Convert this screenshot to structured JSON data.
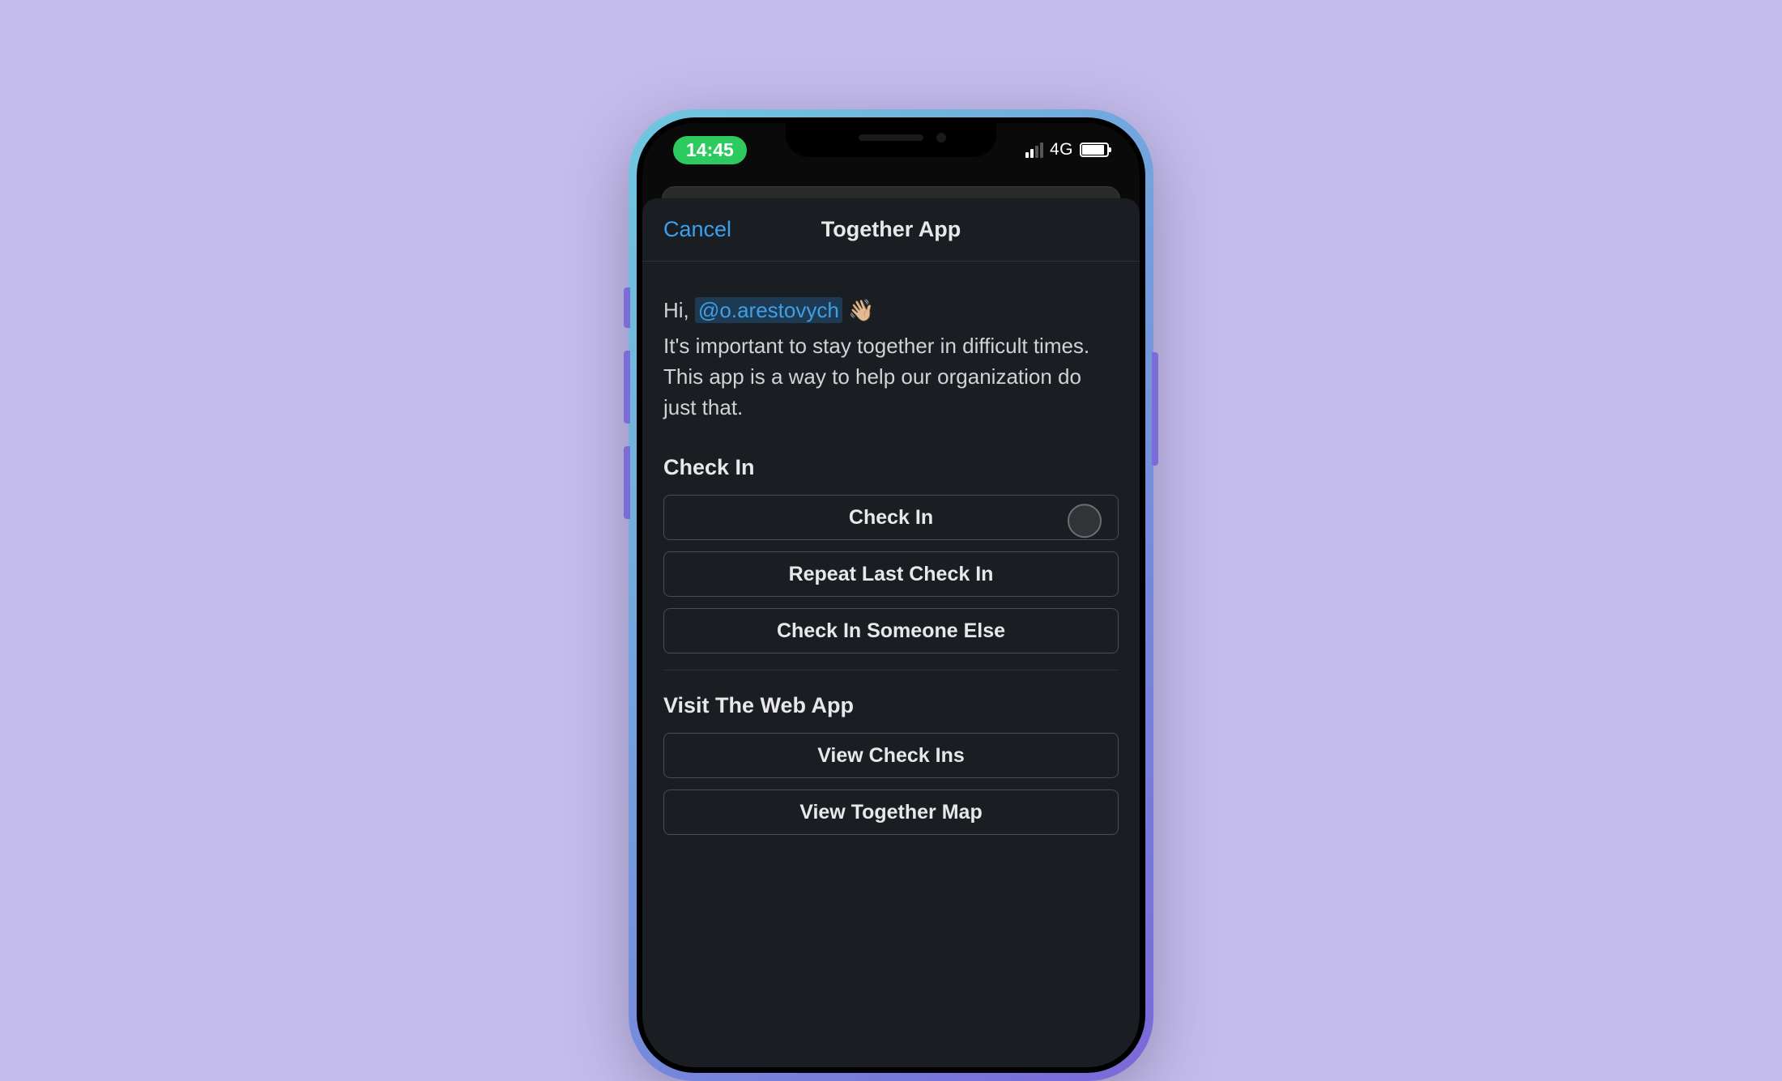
{
  "statusBar": {
    "time": "14:45",
    "network": "4G"
  },
  "navBar": {
    "cancel": "Cancel",
    "title": "Together App"
  },
  "greeting": {
    "prefix": "Hi, ",
    "mention": "@o.arestovych",
    "wave": "👋🏼"
  },
  "description": "It's important to stay together in difficult times. This app is a way to help our organization do just that.",
  "sections": {
    "checkIn": {
      "title": "Check In",
      "buttons": {
        "checkIn": "Check In",
        "repeat": "Repeat Last Check In",
        "someoneElse": "Check In Someone Else"
      }
    },
    "webApp": {
      "title": "Visit The Web App",
      "buttons": {
        "viewCheckIns": "View Check Ins",
        "viewMap": "View Together Map"
      }
    }
  }
}
